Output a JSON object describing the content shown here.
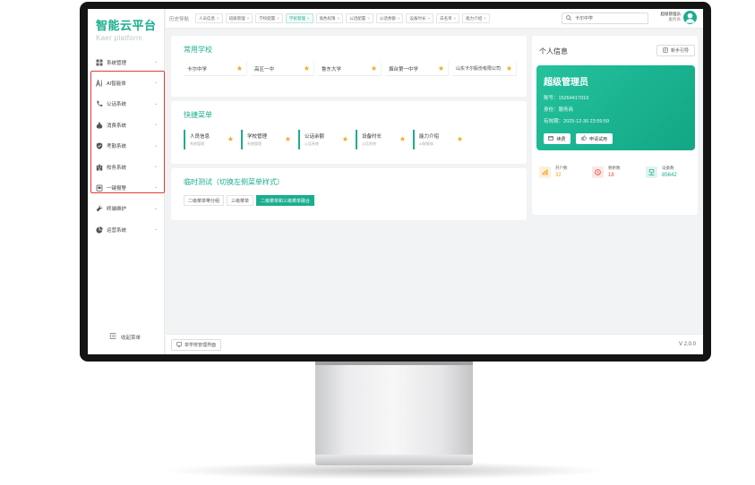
{
  "brand": {
    "title": "智能云平台",
    "subtitle": "Kaer platform"
  },
  "sidebar": {
    "items": [
      {
        "label": "系统管理",
        "icon": "grid-icon"
      },
      {
        "label": "AI智能体",
        "icon": "ai-icon"
      },
      {
        "label": "公话系统",
        "icon": "phone-icon"
      },
      {
        "label": "消费系统",
        "icon": "money-bag-icon"
      },
      {
        "label": "考勤系统",
        "icon": "shield-check-icon"
      },
      {
        "label": "校务系统",
        "icon": "school-icon"
      },
      {
        "label": "一键报警",
        "icon": "alarm-icon"
      },
      {
        "label": "终端维护",
        "icon": "wrench-icon"
      },
      {
        "label": "运营系统",
        "icon": "pie-icon"
      }
    ],
    "collapse_label": "收起菜单"
  },
  "topbar": {
    "history_label": "历史导航",
    "tabs": [
      {
        "label": "人员信息"
      },
      {
        "label": "班级管理"
      },
      {
        "label": "学校配置"
      },
      {
        "label": "学校管理"
      },
      {
        "label": "角色权限"
      },
      {
        "label": "公话配置"
      },
      {
        "label": "公话余额"
      },
      {
        "label": "设备时长"
      },
      {
        "label": "白名单"
      },
      {
        "label": "能力介绍"
      }
    ],
    "active_tab_index": 3,
    "search_value": "卡尔中学",
    "user_name": "超级管理员",
    "user_role": "服务商"
  },
  "common_schools": {
    "title": "常用学校",
    "items": [
      "卡尔中学",
      "高区一中",
      "鲁东大学",
      "烟台第一中学",
      "山东卡尔股份有限公司"
    ]
  },
  "quick_menu": {
    "title": "快捷菜单",
    "items": [
      {
        "name": "人员信息",
        "sub": "系统管理"
      },
      {
        "name": "学校管理",
        "sub": "系统管理"
      },
      {
        "name": "公话余额",
        "sub": "公话系统"
      },
      {
        "name": "设备时长",
        "sub": "公话系统"
      },
      {
        "name": "能力介绍",
        "sub": "AI智能体"
      }
    ]
  },
  "temp_test": {
    "title": "临时测试（切换左侧菜单样式）",
    "buttons": [
      "二级菜单带分组",
      "三级菜单",
      "二级菜单和三级菜单融合"
    ],
    "active_index": 2
  },
  "profile": {
    "title": "个人信息",
    "guide_label": "新手引导",
    "card_title": "超级管理员",
    "account_label": "账号：",
    "account": "15264417919",
    "identity_label": "身份：",
    "identity": "服务商",
    "expiry_label": "有效期：",
    "expiry": "2025-12-30 23:59:59",
    "renew_label": "续费",
    "trial_label": "申请试用",
    "accent_color": "#1aae8e"
  },
  "stats": [
    {
      "label": "开户数",
      "value": "32",
      "color": "#f5a623",
      "icon": "chart-icon"
    },
    {
      "label": "剩余数",
      "value": "18",
      "color": "#e74c3c",
      "icon": "clock-icon"
    },
    {
      "label": "设备数",
      "value": "85642",
      "color": "#1aae8e",
      "icon": "device-icon"
    }
  ],
  "footer": {
    "button_label": "单学校管理界面",
    "version": "V 2.0.0"
  }
}
